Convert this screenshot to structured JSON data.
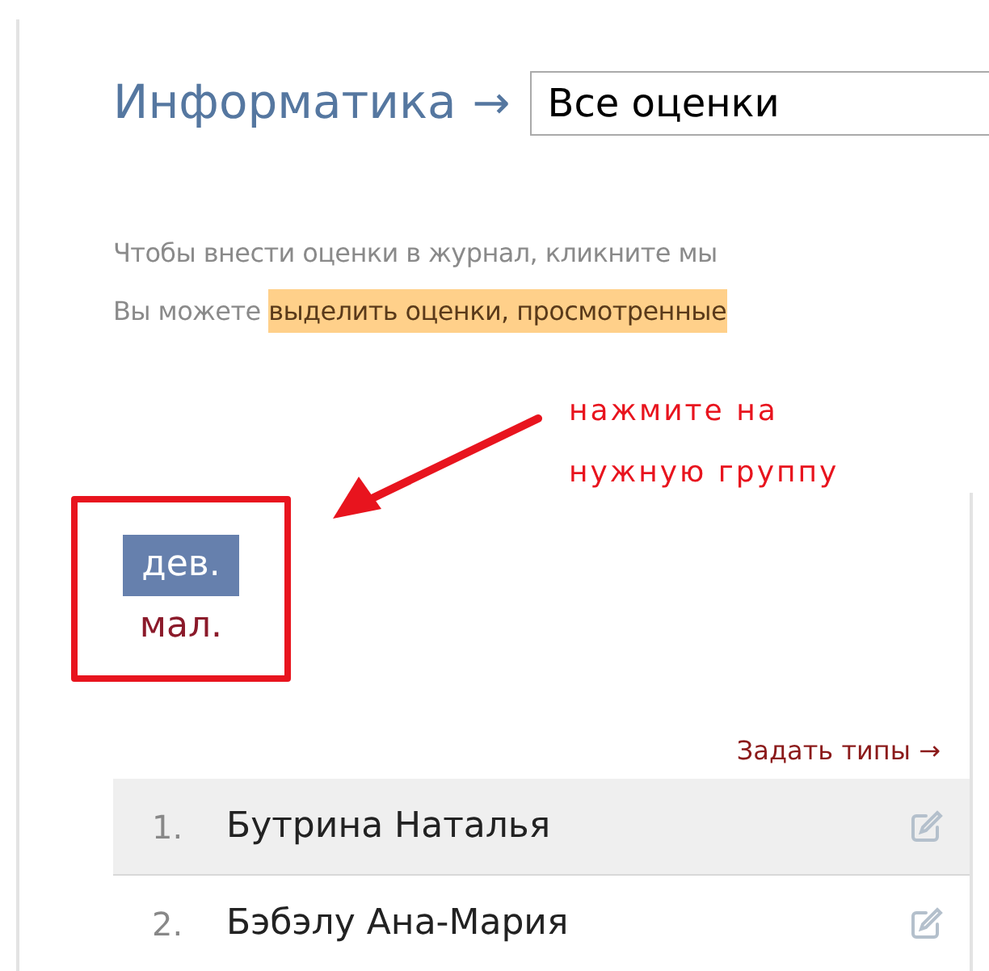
{
  "header": {
    "subject": "Информатика",
    "arrow": "→",
    "select_value": "Все оценки"
  },
  "hints": [
    {
      "text": "Чтобы внести оценки в журнал, кликните мы"
    },
    {
      "text": "Вы можете ",
      "highlight": "выделить оценки, просмотренные"
    }
  ],
  "annotation": {
    "lines": [
      "нажмите на",
      "нужную группу"
    ]
  },
  "groups": [
    {
      "label": "дев.",
      "selected": true
    },
    {
      "label": "мал.",
      "selected": false
    }
  ],
  "set_types_link": "Задать типы →",
  "students": [
    {
      "number": "1.",
      "name": "Бутрина Наталья",
      "hovered": true
    },
    {
      "number": "2.",
      "name": "Бэбэлу Ана-Мария",
      "hovered": false
    }
  ]
}
